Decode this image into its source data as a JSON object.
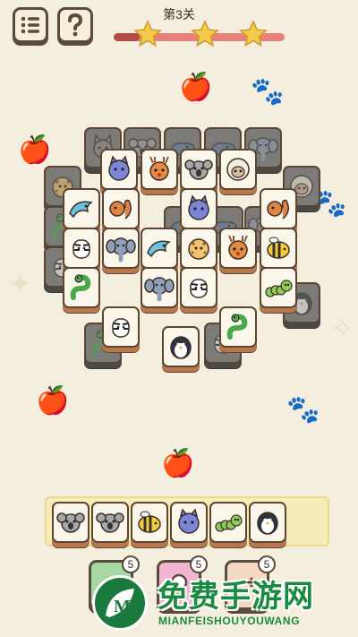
{
  "header": {
    "menu_icon": "list-icon",
    "help_icon": "question-mark-icon",
    "level_title": "第3关",
    "progress_fraction": 0.15,
    "stars": [
      "star-icon",
      "star-icon",
      "star-icon"
    ],
    "star_color": "#f5c94a"
  },
  "board": {
    "tile_border_color": "#5b4533",
    "tile_base_color": "#b9774b",
    "dim_tiles": [
      "wolf",
      "koala",
      "whale",
      "whale",
      "elephant",
      "leopard",
      "sheep",
      "snake",
      "zebra",
      "whale",
      "whale",
      "elephant",
      "snake",
      "zebra",
      "penguin"
    ],
    "active_tiles": [
      "cat",
      "deer",
      "koala",
      "sheep",
      "dolphin",
      "squirrel",
      "cat",
      "squirrel",
      "zebra",
      "elephant",
      "dolphin",
      "leopard",
      "deer",
      "bee",
      "snake",
      "elephant",
      "zebra",
      "caterpillar",
      "zebra",
      "snake",
      "penguin"
    ]
  },
  "tray": {
    "tiles": [
      "koala",
      "koala",
      "bee",
      "cat",
      "caterpillar",
      "penguin"
    ],
    "capacity_slots": 7
  },
  "tools": [
    {
      "name": "undo",
      "icon": "hand-icon",
      "count": "5",
      "color": "#a6d8a3"
    },
    {
      "name": "hint",
      "icon": "bulb-icon",
      "count": "5",
      "color": "#f2b7d0"
    },
    {
      "name": "shuffle",
      "icon": "shuffle-icon",
      "count": "5",
      "color": "#f4d9c2"
    }
  ],
  "watermark": {
    "text_cn": "免费手游网",
    "text_en": "MIANFEISHOUYOUWANG",
    "logo_letter": "M"
  }
}
